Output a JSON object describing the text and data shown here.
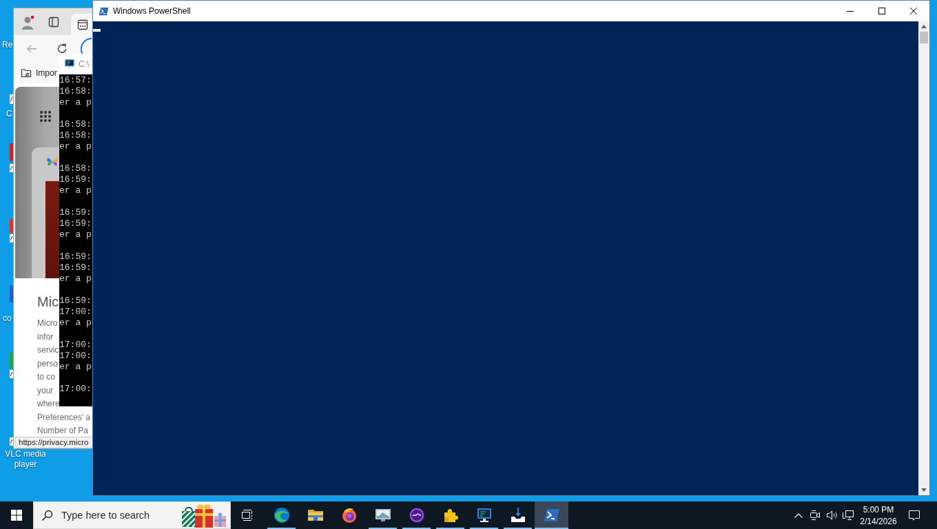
{
  "desktop": {
    "icons": [
      {
        "label": "Re"
      },
      {
        "label": "C"
      },
      {
        "label": "co"
      },
      {
        "label": "VLC media player"
      }
    ]
  },
  "browser": {
    "favorites": [
      {
        "label": "Impor"
      }
    ],
    "article": {
      "heading": "Mic",
      "lines": [
        "Micro",
        "infor",
        "servic",
        "perso",
        "to co",
        "your",
        "where",
        "Preferences' a",
        "Number of Pa"
      ]
    },
    "status_url": "https://privacy.micro"
  },
  "console_window": {
    "title": "C:\\",
    "groups": [
      [
        "16:57:",
        "16:58:",
        "er a p"
      ],
      [
        "16:58:",
        "16:58:",
        "er a p"
      ],
      [
        "16:58:",
        "16:59:",
        "er a p"
      ],
      [
        "16:59:",
        "16:59:",
        "er a p"
      ],
      [
        "16:59:",
        "16:59:",
        "er a p"
      ],
      [
        "16:59:",
        "17:00:",
        "er a p"
      ],
      [
        "17:00:",
        "17:00:",
        "er a p"
      ],
      [
        "17:00:"
      ]
    ]
  },
  "powershell_window": {
    "title": "Windows PowerShell"
  },
  "taskbar": {
    "search": {
      "placeholder": "Type here to search"
    },
    "apps": [
      {
        "kind": "swirl",
        "running": true,
        "selected": false
      },
      {
        "kind": "folder",
        "running": false,
        "selected": false
      },
      {
        "kind": "fox",
        "running": false,
        "selected": false
      },
      {
        "kind": "monitor",
        "running": true,
        "selected": false
      },
      {
        "kind": "orb",
        "running": true,
        "selected": false
      },
      {
        "kind": "puzzle",
        "running": true,
        "selected": false
      },
      {
        "kind": "terminal",
        "running": true,
        "selected": false
      },
      {
        "kind": "download",
        "running": true,
        "selected": false
      },
      {
        "kind": "shell",
        "running": true,
        "selected": true
      }
    ],
    "clock": {
      "time": "5:00 PM",
      "date": "2/14/2026"
    }
  }
}
